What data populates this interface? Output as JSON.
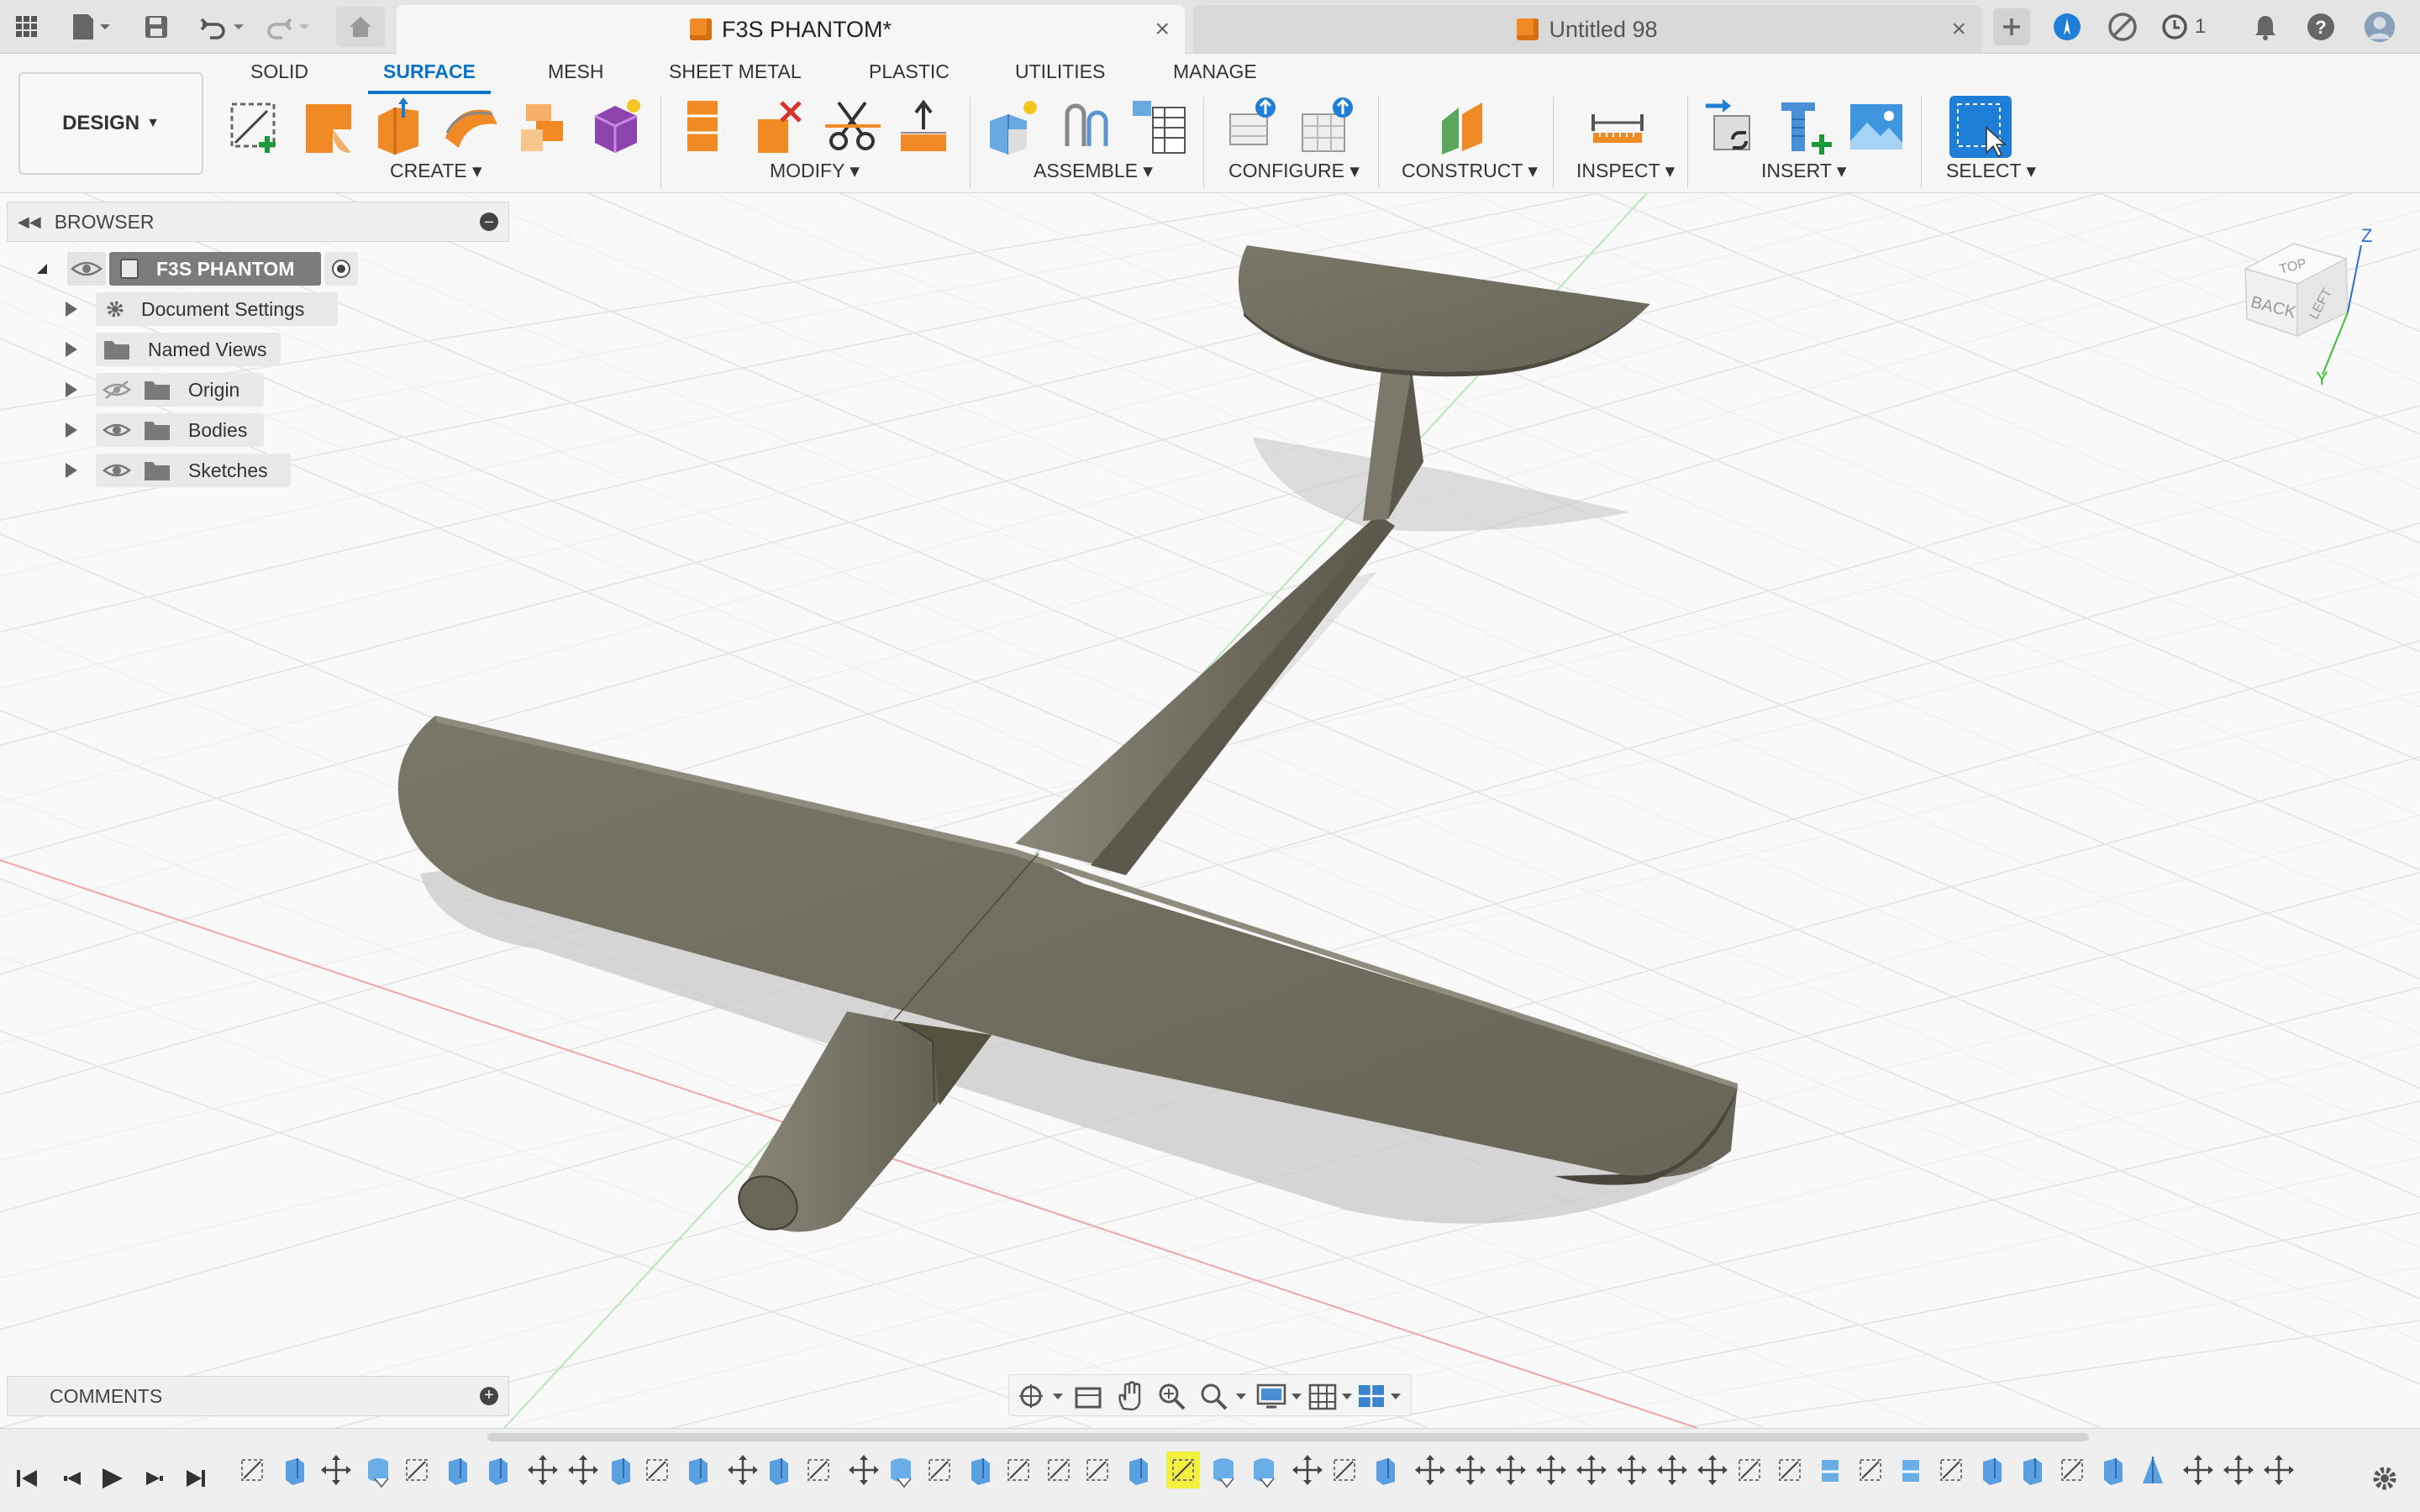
{
  "window": {
    "active_tab": "F3S PHANTOM*",
    "inactive_tab": "Untitled 98",
    "job_count": "1"
  },
  "ribbon": {
    "workspace_button": "DESIGN",
    "workspace_tabs": [
      "SOLID",
      "SURFACE",
      "MESH",
      "SHEET METAL",
      "PLASTIC",
      "UTILITIES",
      "MANAGE"
    ],
    "active_workspace_tab": "SURFACE",
    "groups": {
      "create": "CREATE",
      "modify": "MODIFY",
      "assemble": "ASSEMBLE",
      "configure": "CONFIGURE",
      "construct": "CONSTRUCT",
      "inspect": "INSPECT",
      "insert": "INSERT",
      "select": "SELECT"
    }
  },
  "browser": {
    "title": "BROWSER",
    "root": "F3S PHANTOM",
    "items": [
      "Document Settings",
      "Named Views",
      "Origin",
      "Bodies",
      "Sketches"
    ]
  },
  "comments": {
    "title": "COMMENTS"
  },
  "viewcube": {
    "top": "TOP",
    "back": "BACK",
    "left": "LEFT",
    "axis_z": "Z",
    "axis_y": "Y"
  },
  "colors": {
    "accent": "#0a73c9",
    "model": "#6f6b60",
    "tool_orange": "#f08a24"
  }
}
